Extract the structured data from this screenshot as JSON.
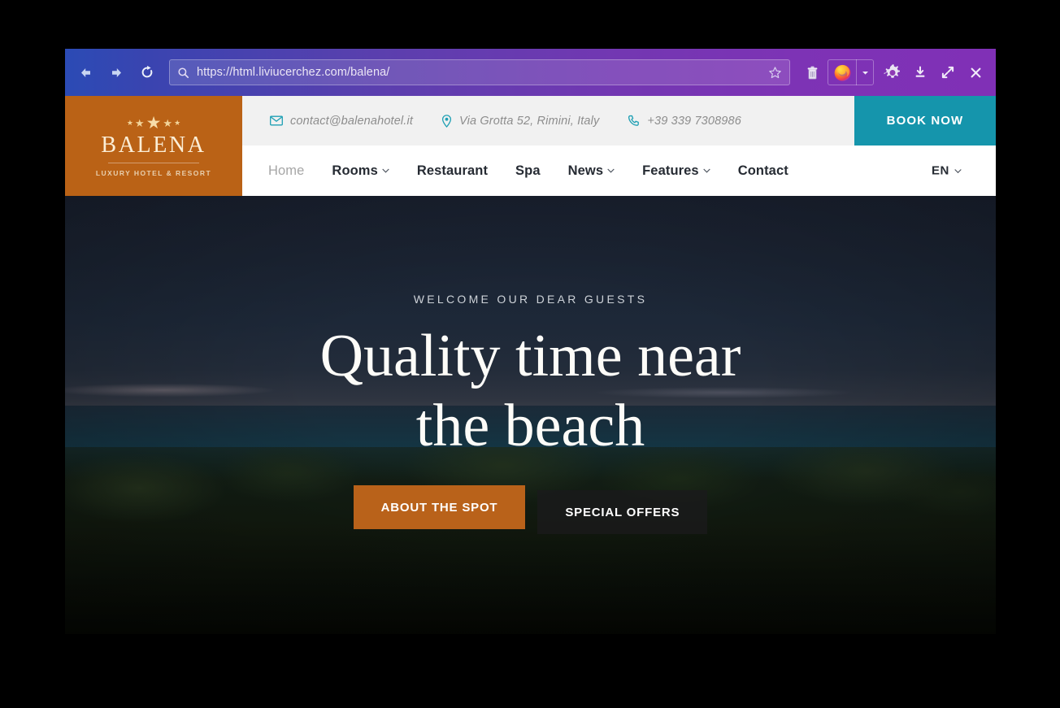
{
  "browser": {
    "back_icon": "arrow-left-icon",
    "forward_icon": "arrow-right-icon",
    "reload_icon": "reload-icon",
    "url": "https://html.liviucerchez.com/balena/",
    "url_placeholder": "Search or enter address",
    "search_icon": "search-icon",
    "bookmark_icon": "star-icon",
    "trash_icon": "trash-icon",
    "firefox_icon": "firefox-icon",
    "firefox_caret_icon": "chevron-down-icon",
    "settings_icon": "gear-icon",
    "download_icon": "download-icon",
    "maximize_icon": "maximize-icon",
    "close_icon": "close-icon"
  },
  "site": {
    "logo": {
      "brand": "BALENA",
      "tagline": "LUXURY HOTEL & RESORT",
      "star_glyph": "★",
      "star_count": 5
    },
    "contact": [
      {
        "icon": "mail-icon",
        "text": "contact@balenahotel.it",
        "name": "contact-email"
      },
      {
        "icon": "location-pin-icon",
        "text": "Via Grotta 52, Rimini, Italy",
        "name": "contact-address"
      },
      {
        "icon": "phone-icon",
        "text": "+39 339 7308986",
        "name": "contact-phone"
      }
    ],
    "book_now": "BOOK NOW",
    "nav": [
      {
        "label": "Home",
        "has_caret": false,
        "active": false,
        "inactive": true
      },
      {
        "label": "Rooms",
        "has_caret": true,
        "inactive": false
      },
      {
        "label": "Restaurant",
        "has_caret": false,
        "inactive": false
      },
      {
        "label": "Spa",
        "has_caret": false,
        "inactive": false
      },
      {
        "label": "News",
        "has_caret": true,
        "inactive": false
      },
      {
        "label": "Features",
        "has_caret": true,
        "inactive": false
      },
      {
        "label": "Contact",
        "has_caret": false,
        "inactive": false
      }
    ],
    "language": "EN",
    "hero": {
      "eyebrow": "WELCOME OUR DEAR GUESTS",
      "title_line1": "Quality time near",
      "title_line2": "the beach",
      "cta_primary": "ABOUT THE SPOT",
      "cta_secondary": "SPECIAL OFFERS"
    }
  },
  "colors": {
    "logo_bg": "#ba6216",
    "book_now_bg": "#1595ac",
    "cta_primary_bg": "#b9621a",
    "cta_secondary_bg": "rgba(26,26,28,0.80)",
    "contact_icon": "#1fa0b4",
    "toolbar_gradient_start": "#2b4bb5",
    "toolbar_gradient_end": "#8030b6"
  }
}
